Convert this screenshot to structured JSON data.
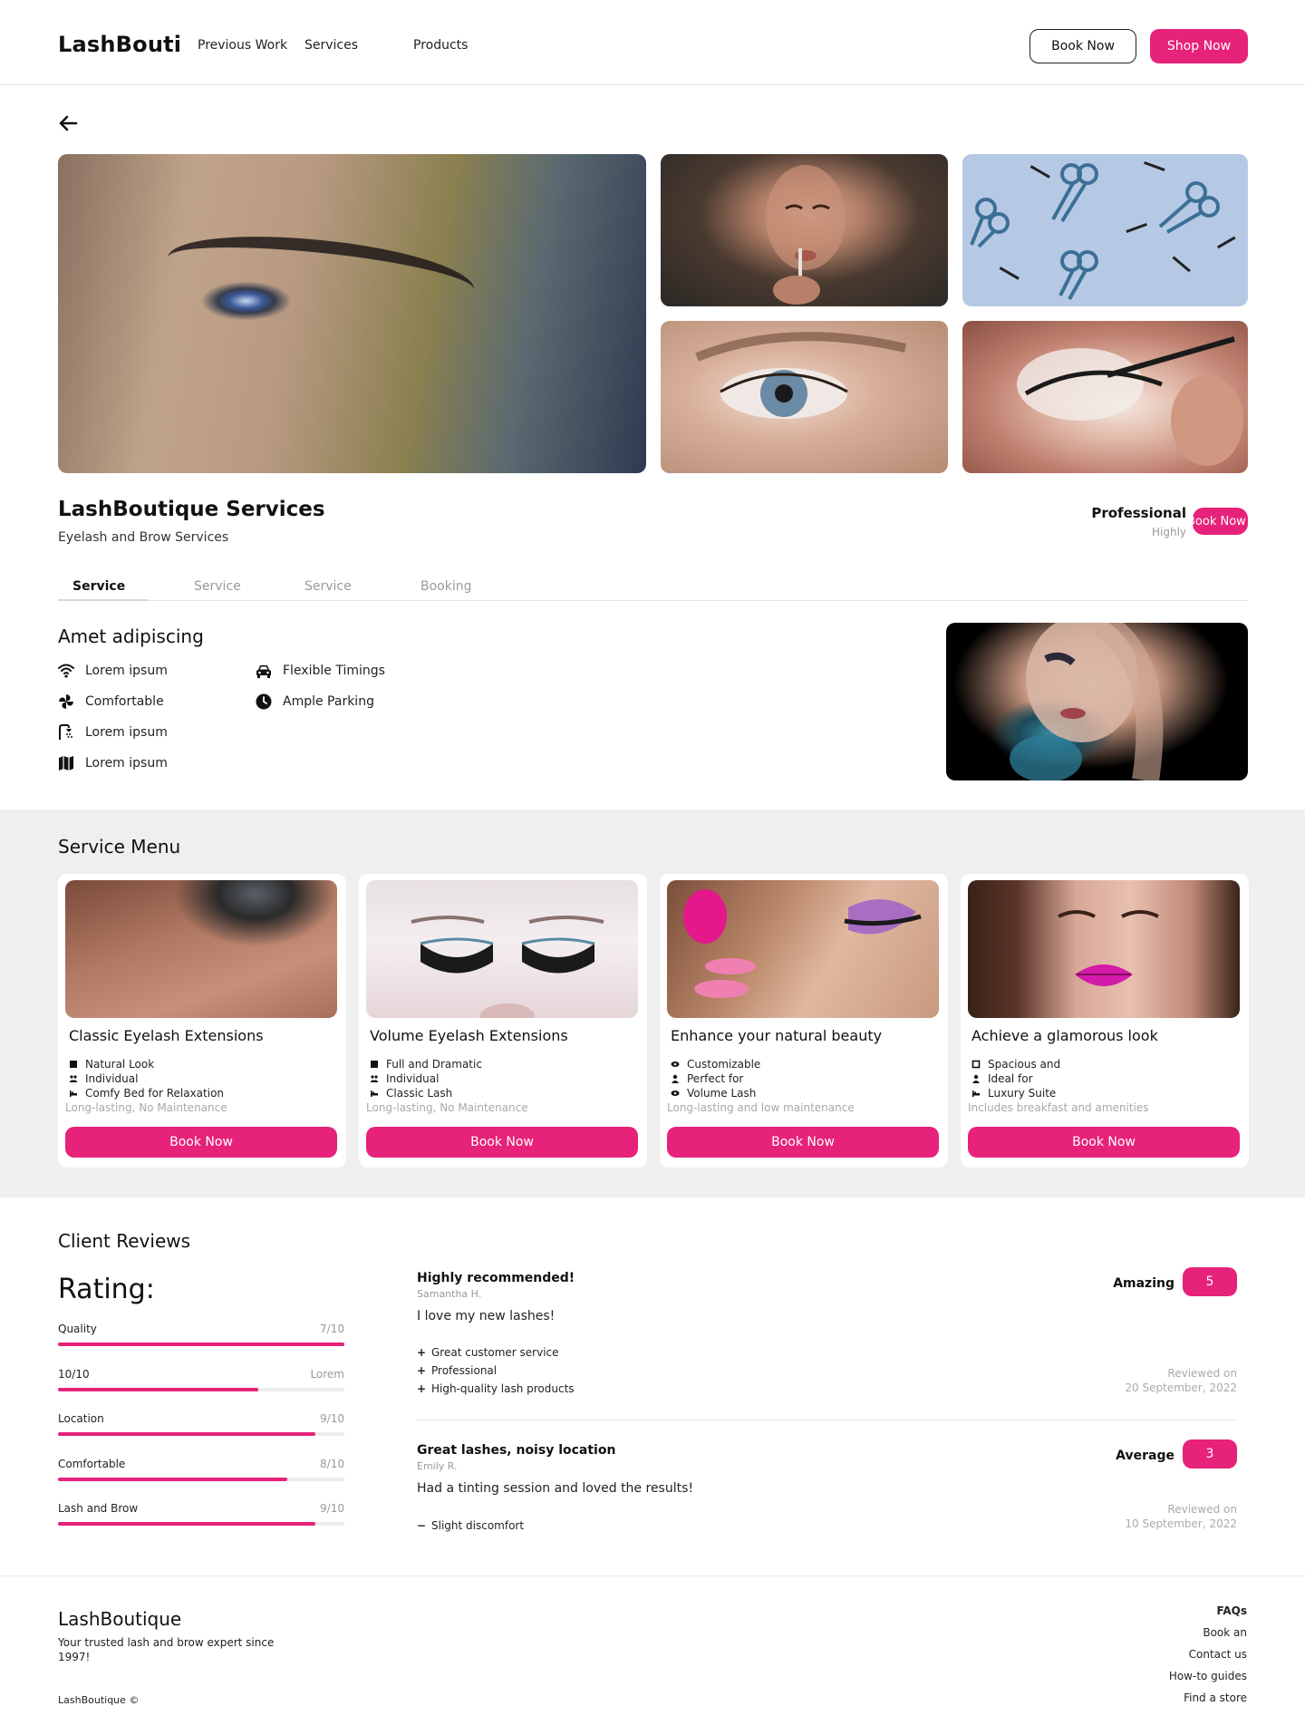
{
  "header": {
    "logo": "LashBouti",
    "nav": [
      "Previous Work",
      "Services",
      "Products"
    ],
    "book_label": "Book Now",
    "shop_label": "Shop Now"
  },
  "business": {
    "title": "LashBoutique Services",
    "subtitle": "Eyelash and Brow Services",
    "badge_label": "Professional",
    "badge_sub": "Highly",
    "book_label": "Book Now"
  },
  "tabs": [
    "Service",
    "Service",
    "Service",
    "Booking"
  ],
  "amenities": {
    "title": "Amet adipiscing",
    "items": [
      {
        "label": "Lorem ipsum",
        "icon": "wifi-icon"
      },
      {
        "label": "Comfortable",
        "icon": "fan-icon"
      },
      {
        "label": "Lorem ipsum",
        "icon": "shower-icon"
      },
      {
        "label": "Lorem ipsum",
        "icon": "map-icon"
      },
      {
        "label": "Flexible Timings",
        "icon": "car-icon"
      },
      {
        "label": "Ample Parking",
        "icon": "clock-icon"
      }
    ]
  },
  "menu": {
    "title": "Service Menu",
    "cards": [
      {
        "title": "Classic Eyelash Extensions",
        "features": [
          "Natural Look",
          "Individual",
          "Comfy Bed for Relaxation"
        ],
        "note": "Long-lasting, No Maintenance",
        "button": "Book Now"
      },
      {
        "title": "Volume Eyelash Extensions",
        "features": [
          "Full and Dramatic",
          "Individual",
          "Classic Lash"
        ],
        "note": "Long-lasting, No Maintenance",
        "button": "Book Now"
      },
      {
        "title": "Enhance your natural beauty",
        "features": [
          "Customizable",
          "Perfect for",
          "Volume Lash"
        ],
        "note": "Long-lasting and low maintenance",
        "button": "Book Now"
      },
      {
        "title": "Achieve a glamorous look",
        "features": [
          "Spacious and",
          "Ideal for",
          "Luxury Suite"
        ],
        "note": "Includes breakfast and amenities",
        "button": "Book Now"
      }
    ]
  },
  "reviews": {
    "title": "Client Reviews",
    "rating_heading": "Rating:",
    "bars": [
      {
        "label": "Quality",
        "value": "7/10",
        "fill": 1.0
      },
      {
        "label": "10/10",
        "value": "Lorem",
        "fill": 0.7
      },
      {
        "label": "Location",
        "value": "9/10",
        "fill": 0.9
      },
      {
        "label": "Comfortable",
        "value": "8/10",
        "fill": 0.8
      },
      {
        "label": "Lash and Brow",
        "value": "9/10",
        "fill": 0.9
      }
    ],
    "items": [
      {
        "headline": "Highly recommended!",
        "author": "Samantha H.",
        "text": "I love my new lashes!",
        "label": "Amazing",
        "score": "5",
        "points": [
          "Great customer service",
          "Professional",
          "High-quality lash products"
        ],
        "point_symbol": "+",
        "reviewed_on": "Reviewed on",
        "date": "20 September, 2022"
      },
      {
        "headline": "Great lashes, noisy location",
        "author": "Emily R.",
        "text": "Had a tinting session and loved the results!",
        "label": "Average",
        "score": "3",
        "points": [
          "Slight discomfort"
        ],
        "point_symbol": "−",
        "reviewed_on": "Reviewed on",
        "date": "10 September, 2022"
      }
    ]
  },
  "footer": {
    "logo": "LashBoutique",
    "tagline": "Your trusted lash and brow expert since 1997!",
    "copyright": "LashBoutique ©",
    "links": [
      "FAQs",
      "Book an",
      "Contact us",
      "How-to guides",
      "Find a store"
    ]
  },
  "colors": {
    "accent": "#e6227a",
    "menu_bg": "#efefef"
  }
}
